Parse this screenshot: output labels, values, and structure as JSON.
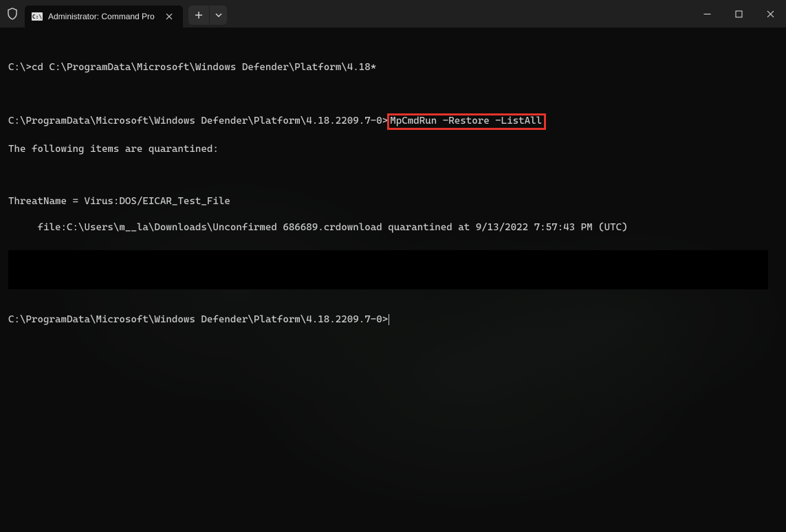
{
  "titlebar": {
    "tab_title": "Administrator: Command Pro"
  },
  "terminal": {
    "line1_prompt": "C:\\>",
    "line1_cmd": "cd C:\\ProgramData\\Microsoft\\Windows Defender\\Platform\\4.18*",
    "line2_prompt": "C:\\ProgramData\\Microsoft\\Windows Defender\\Platform\\4.18.2209.7-0>",
    "line2_cmd": "MpCmdRun -Restore -ListAll",
    "line3": "The following items are quarantined:",
    "line4": "ThreatName = Virus:DOS/EICAR_Test_File",
    "line5": "     file:C:\\Users\\m__la\\Downloads\\Unconfirmed 686689.crdownload quarantined at 9/13/2022 7:57:43 PM (UTC)",
    "line6_prompt": "C:\\ProgramData\\Microsoft\\Windows Defender\\Platform\\4.18.2209.7-0>"
  }
}
